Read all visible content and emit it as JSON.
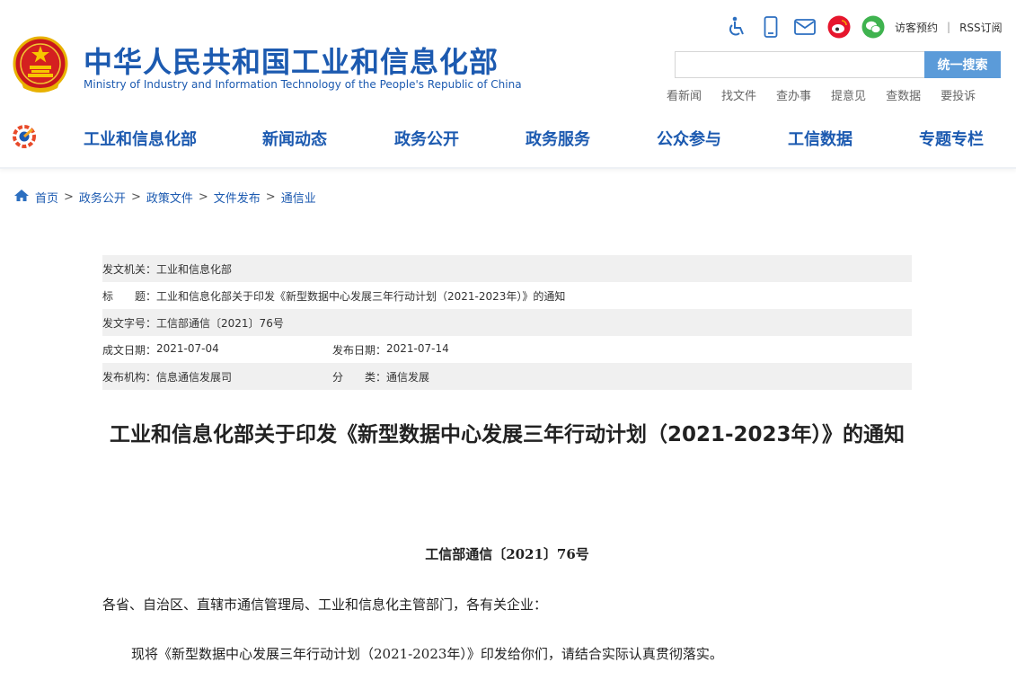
{
  "header": {
    "brand_cn": "中华人民共和国工业和信息化部",
    "brand_en": "Ministry of Industry and Information Technology of the People's Republic of China",
    "util": {
      "icons": [
        "accessibility-icon",
        "mobile-icon",
        "mail-icon",
        "weibo-icon",
        "wechat-icon"
      ],
      "appointment": "访客预约",
      "separator": "|",
      "rss": "RSS订阅"
    },
    "search": {
      "placeholder": "",
      "button": "统一搜索"
    },
    "quick_links": [
      "看新闻",
      "找文件",
      "查办事",
      "提意见",
      "查数据",
      "要投诉"
    ]
  },
  "nav": {
    "items": [
      "工业和信息化部",
      "新闻动态",
      "政务公开",
      "政务服务",
      "公众参与",
      "工信数据",
      "专题专栏"
    ]
  },
  "breadcrumb": [
    "首页",
    "政务公开",
    "政策文件",
    "文件发布",
    "通信业"
  ],
  "info": {
    "issuer_label": "发文机关：",
    "issuer": "工业和信息化部",
    "title_label": "标　　题：",
    "title": "工业和信息化部关于印发《新型数据中心发展三年行动计划（2021-2023年）》的通知",
    "docno_label": "发文字号：",
    "docno": "工信部通信〔2021〕76号",
    "created_label": "成文日期：",
    "created": "2021-07-04",
    "published_label": "发布日期：",
    "published": "2021-07-14",
    "org_label": "发布机构：",
    "org": "信息通信发展司",
    "category_label": "分　　类：",
    "category": "通信发展"
  },
  "article": {
    "title": "工业和信息化部关于印发《新型数据中心发展三年行动计划（2021-2023年）》的通知",
    "docno": "工信部通信〔2021〕76号",
    "salutation": "各省、自治区、直辖市通信管理局、工业和信息化主管部门，各有关企业：",
    "body": "现将《新型数据中心发展三年行动计划（2021-2023年）》印发给你们，请结合实际认真贯彻落实。"
  },
  "colors": {
    "brand_blue": "#1c5ab0",
    "search_button": "#5b9bd9",
    "info_row_shade": "#f0f0f0"
  }
}
